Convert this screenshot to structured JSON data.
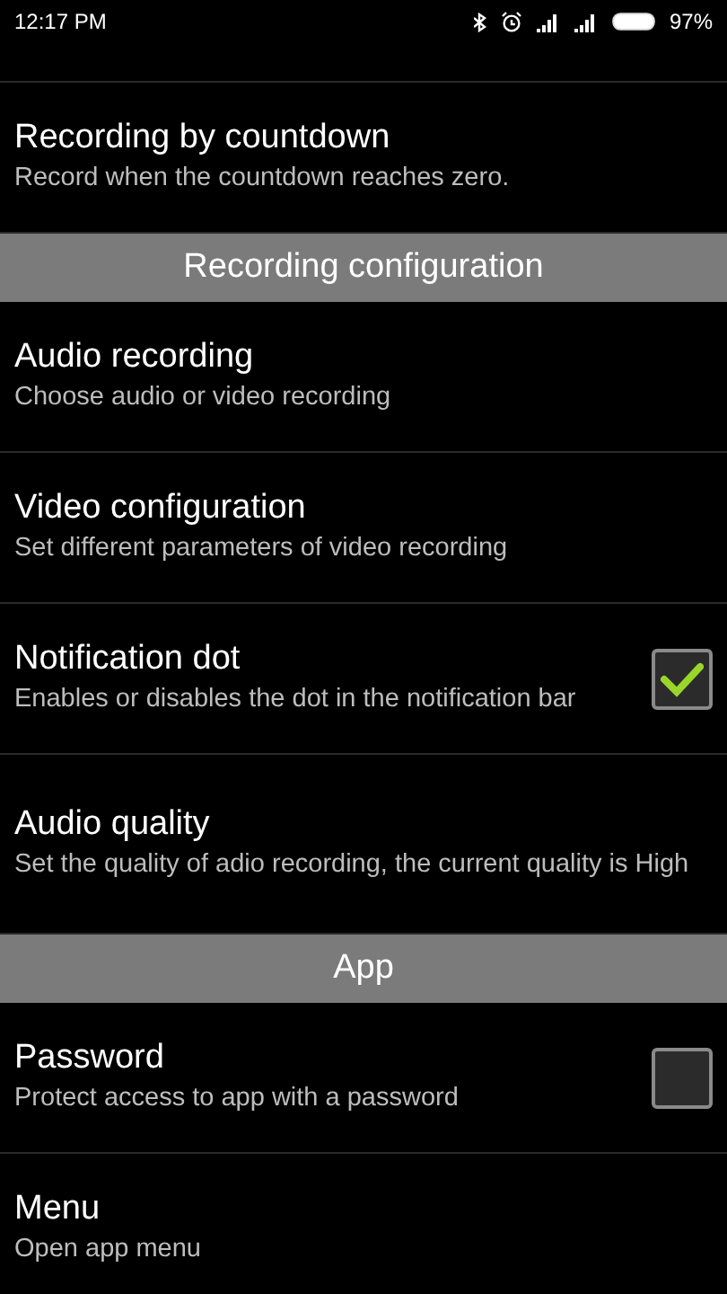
{
  "status_bar": {
    "time": "12:17 PM",
    "battery": "97%"
  },
  "sections": [
    {
      "items": [
        {
          "kind": "plain",
          "title": "Recording by countdown",
          "summary": "Record when the countdown reaches zero."
        }
      ]
    },
    {
      "header": "Recording configuration",
      "items": [
        {
          "kind": "plain",
          "title": "Audio recording",
          "summary": "Choose audio or video recording"
        },
        {
          "kind": "plain",
          "title": "Video configuration",
          "summary": "Set different parameters of video recording"
        },
        {
          "kind": "checkbox",
          "title": "Notification dot",
          "summary": "Enables or disables the dot in the notification bar",
          "checked": true
        },
        {
          "kind": "plain",
          "title": "Audio quality",
          "summary": "Set the quality of adio recording, the current quality is High"
        }
      ]
    },
    {
      "header": "App",
      "items": [
        {
          "kind": "checkbox",
          "title": "Password",
          "summary": "Protect access to app with a password",
          "checked": false
        },
        {
          "kind": "plain",
          "title": "Menu",
          "summary": "Open app menu"
        }
      ]
    }
  ]
}
